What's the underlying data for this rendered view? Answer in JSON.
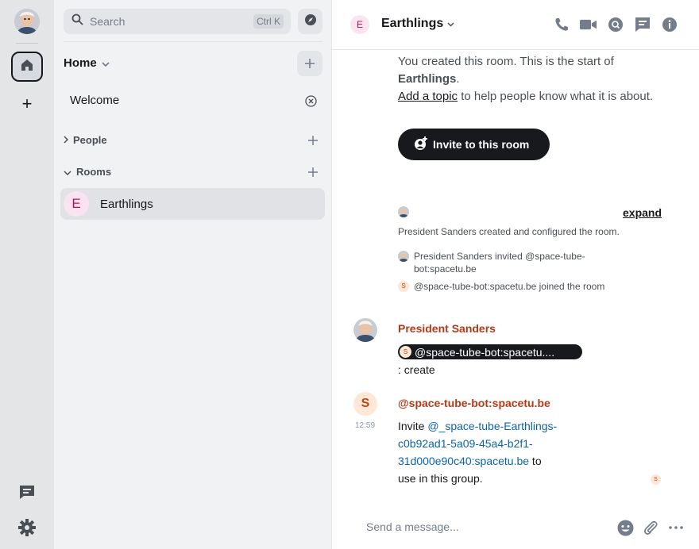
{
  "colors": {
    "accent": "#17191c",
    "sender_sanders": "#b43a17",
    "sender_bot": "#b43a17",
    "link": "#0b64a8",
    "room_avatar_bg": "#fbe4ef",
    "room_avatar_fg": "#b0125f"
  },
  "spacebar": {
    "user_avatar_icon": "user-photo",
    "home_icon": "home-icon",
    "add_space_label": "+"
  },
  "roomlist": {
    "search_placeholder": "Search",
    "search_shortcut": "Ctrl K",
    "home_title": "Home",
    "welcome_label": "Welcome",
    "sections": [
      {
        "label": "People"
      },
      {
        "label": "Rooms"
      }
    ],
    "rooms": [
      {
        "avatar_letter": "E",
        "name": "Earthlings"
      }
    ]
  },
  "header": {
    "avatar_letter": "E",
    "room_name": "Earthlings"
  },
  "timeline": {
    "intro_line1": "You created this room. This is the start of",
    "intro_room": "Earthlings",
    "intro_room_suffix": ".",
    "add_topic": "Add a topic",
    "intro_line3": " to help people know what it is about.",
    "invite_label": "Invite to this room",
    "expand_label": "expand",
    "created_text": "President Sanders created and configured the room.",
    "state_events": [
      {
        "text": "President Sanders invited @space-tube-bot:spacetu.be"
      },
      {
        "avatar_letter": "S",
        "text": "@space-tube-bot:spacetu.be joined the room"
      }
    ],
    "messages": [
      {
        "sender": "President Sanders",
        "pill_letter": "S",
        "pill_text": "@space-tube-bot:spacetu....",
        "body": ": create"
      },
      {
        "sender": "@space-tube-bot:spacetu.be",
        "avatar_letter": "S",
        "time": "12:59",
        "body_prefix": "Invite ",
        "mention_line1": "@_space-tube-Earthlings-",
        "mention_line2": "c0b92ad1-5a09-45a4-b2f1-",
        "mention_line3": "31d000e90c40:spacetu.be",
        "body_suffix1": " to",
        "body_line4": "use in this group.",
        "read_receipt_letter": "S"
      }
    ]
  },
  "composer": {
    "placeholder": "Send a message..."
  }
}
